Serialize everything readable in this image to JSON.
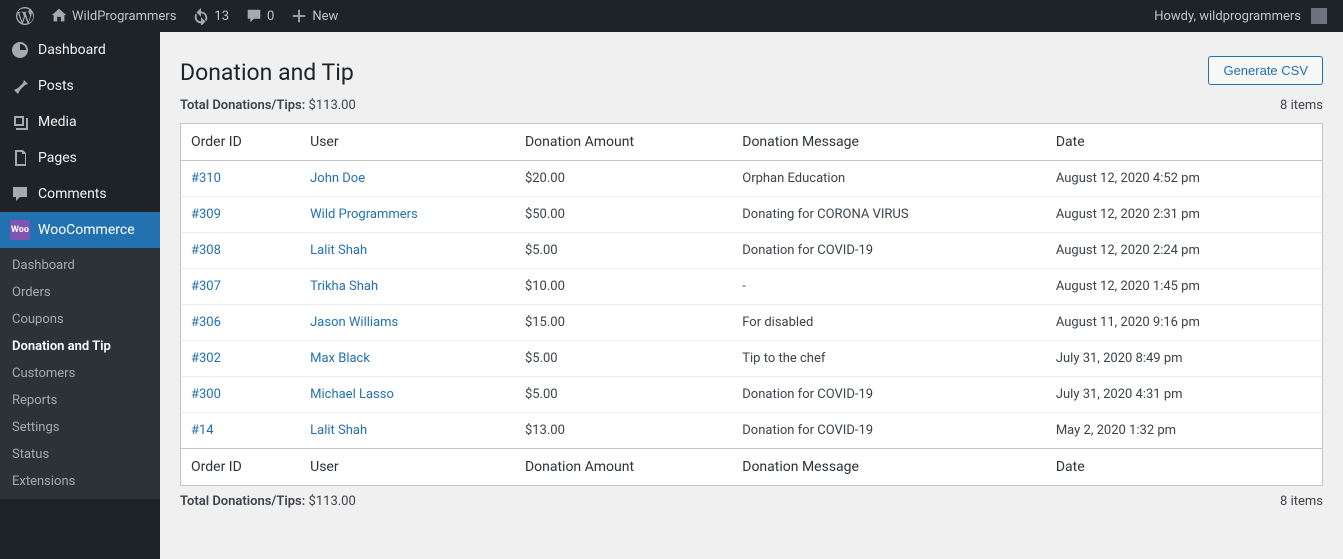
{
  "adminbar": {
    "site_name": "WildProgrammers",
    "updates": "13",
    "comments": "0",
    "new": "New",
    "howdy": "Howdy, wildprogrammers"
  },
  "sidebar": {
    "items": [
      {
        "label": "Dashboard"
      },
      {
        "label": "Posts"
      },
      {
        "label": "Media"
      },
      {
        "label": "Pages"
      },
      {
        "label": "Comments"
      },
      {
        "label": "WooCommerce"
      }
    ],
    "submenu": [
      {
        "label": "Dashboard"
      },
      {
        "label": "Orders"
      },
      {
        "label": "Coupons"
      },
      {
        "label": "Donation and Tip"
      },
      {
        "label": "Customers"
      },
      {
        "label": "Reports"
      },
      {
        "label": "Settings"
      },
      {
        "label": "Status"
      },
      {
        "label": "Extensions"
      }
    ]
  },
  "page": {
    "title": "Donation and Tip",
    "generate_btn": "Generate CSV",
    "total_label": "Total Donations/Tips:",
    "total_value": "$113.00",
    "items_count": "8 items"
  },
  "table": {
    "headers": {
      "order_id": "Order ID",
      "user": "User",
      "amount": "Donation Amount",
      "message": "Donation Message",
      "date": "Date"
    },
    "rows": [
      {
        "order": "#310",
        "user": "John Doe",
        "amount": "$20.00",
        "message": "Orphan Education",
        "date": "August 12, 2020 4:52 pm"
      },
      {
        "order": "#309",
        "user": "Wild Programmers",
        "amount": "$50.00",
        "message": "Donating for CORONA VIRUS",
        "date": "August 12, 2020 2:31 pm"
      },
      {
        "order": "#308",
        "user": "Lalit Shah",
        "amount": "$5.00",
        "message": "Donation for COVID-19",
        "date": "August 12, 2020 2:24 pm"
      },
      {
        "order": "#307",
        "user": "Trikha Shah",
        "amount": "$10.00",
        "message": "-",
        "date": "August 12, 2020 1:45 pm"
      },
      {
        "order": "#306",
        "user": "Jason Williams",
        "amount": "$15.00",
        "message": "For disabled",
        "date": "August 11, 2020 9:16 pm"
      },
      {
        "order": "#302",
        "user": "Max Black",
        "amount": "$5.00",
        "message": "Tip to the chef",
        "date": "July 31, 2020 8:49 pm"
      },
      {
        "order": "#300",
        "user": "Michael Lasso",
        "amount": "$5.00",
        "message": "Donation for COVID-19",
        "date": "July 31, 2020 4:31 pm"
      },
      {
        "order": "#14",
        "user": "Lalit Shah",
        "amount": "$13.00",
        "message": "Donation for COVID-19",
        "date": "May 2, 2020 1:32 pm"
      }
    ]
  }
}
